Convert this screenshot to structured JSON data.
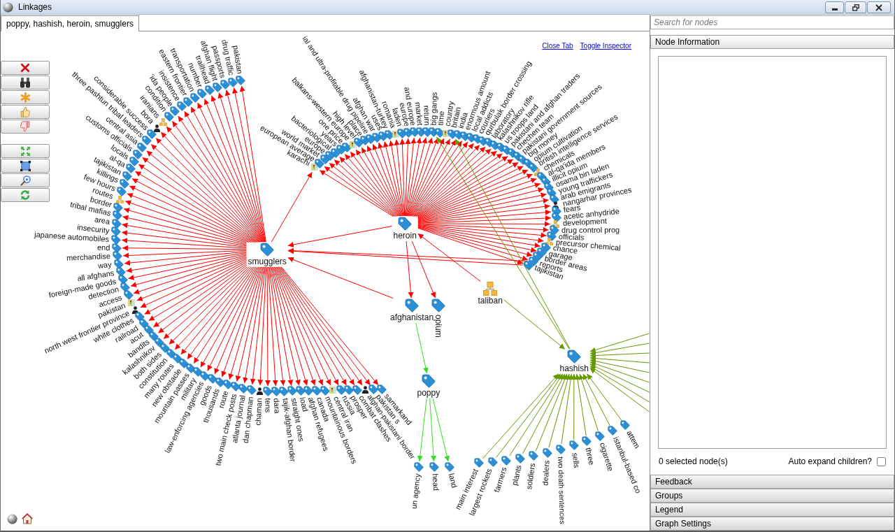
{
  "window": {
    "title": "Linkages"
  },
  "tabs": [
    {
      "label": "poppy, hashish, heroin, smugglers",
      "selected": true
    }
  ],
  "canvas_links": [
    {
      "label": "Close Tab"
    },
    {
      "label": "Toggle Inspector"
    }
  ],
  "graph": {
    "nodes": [
      {
        "label": "smugglers",
        "kind": "term",
        "color": "#ff0000",
        "arrows_point_outward": true,
        "children": [
          {
            "label": "pakistan",
            "kind": "term"
          },
          {
            "label": "drug traffic",
            "kind": "term"
          },
          {
            "label": "passports",
            "kind": "term"
          },
          {
            "label": "afghan flight",
            "kind": "term"
          },
          {
            "label": "trailhead",
            "kind": "term"
          },
          {
            "label": "number",
            "kind": "term"
          },
          {
            "label": "transportation",
            "kind": "term"
          },
          {
            "label": "eastern frontier",
            "kind": "term"
          },
          {
            "label": "insistence",
            "kind": "term"
          },
          {
            "label": "'ida people",
            "kind": "term"
          },
          {
            "label": "condition",
            "kind": "term"
          },
          {
            "label": "iranians",
            "kind": "group"
          },
          {
            "label": "bora",
            "kind": "person"
          },
          {
            "label": "considerable success",
            "kind": "term"
          },
          {
            "label": "three pashtun tribal leaders",
            "kind": "term"
          },
          {
            "label": "central asia",
            "kind": "term"
          },
          {
            "label": "customs officials",
            "kind": "term"
          },
          {
            "label": "locals",
            "kind": "term"
          },
          {
            "label": "al-qa",
            "kind": "term"
          },
          {
            "label": "tajikistan",
            "kind": "term"
          },
          {
            "label": "killings",
            "kind": "term"
          },
          {
            "label": "few hours",
            "kind": "term"
          },
          {
            "label": "routes",
            "kind": "group"
          },
          {
            "label": "border",
            "kind": "term"
          },
          {
            "label": "tribal mafias",
            "kind": "term"
          },
          {
            "label": "area",
            "kind": "term"
          },
          {
            "label": "insecurity",
            "kind": "term"
          },
          {
            "label": "japanese automobiles",
            "kind": "term"
          },
          {
            "label": "end",
            "kind": "term"
          },
          {
            "label": "merchandise",
            "kind": "term"
          },
          {
            "label": "way",
            "kind": "term"
          },
          {
            "label": "all afghans",
            "kind": "term"
          },
          {
            "label": "foreign-made goods",
            "kind": "term"
          },
          {
            "label": "detection",
            "kind": "term"
          },
          {
            "label": "access",
            "kind": "term"
          },
          {
            "label": "pakistan",
            "kind": "place"
          },
          {
            "label": "north west frontier province",
            "kind": "person"
          },
          {
            "label": "white clothes",
            "kind": "term"
          },
          {
            "label": "railroad",
            "kind": "term"
          },
          {
            "label": "acut",
            "kind": "term"
          },
          {
            "label": "bandits",
            "kind": "term"
          },
          {
            "label": "kalashnikov",
            "kind": "term"
          },
          {
            "label": "both sides",
            "kind": "term"
          },
          {
            "label": "constitution",
            "kind": "term"
          },
          {
            "label": "many routes",
            "kind": "term"
          },
          {
            "label": "new obstacle",
            "kind": "term"
          },
          {
            "label": "mountain passes",
            "kind": "term"
          },
          {
            "label": "military",
            "kind": "term"
          },
          {
            "label": "law-enforcing agencies",
            "kind": "term"
          },
          {
            "label": "goods",
            "kind": "term"
          },
          {
            "label": "thousands",
            "kind": "term"
          },
          {
            "label": "route",
            "kind": "term"
          },
          {
            "label": "two main check posts",
            "kind": "term"
          },
          {
            "label": "atlanta journal",
            "kind": "term"
          },
          {
            "label": "dan chapman",
            "kind": "term"
          },
          {
            "label": "chaman",
            "kind": "person"
          },
          {
            "label": "tens",
            "kind": "term"
          },
          {
            "label": "dara",
            "kind": "term"
          },
          {
            "label": "tajik-afghan border",
            "kind": "term"
          },
          {
            "label": "straight ones",
            "kind": "term"
          },
          {
            "label": "load",
            "kind": "term"
          },
          {
            "label": "afghan refugees",
            "kind": "term"
          },
          {
            "label": "canada",
            "kind": "term"
          },
          {
            "label": "mountainous borders",
            "kind": "term"
          },
          {
            "label": "central iran",
            "kind": "place"
          },
          {
            "label": "russia",
            "kind": "term"
          },
          {
            "label": "prosper",
            "kind": "term"
          },
          {
            "label": "combat clashes",
            "kind": "term"
          },
          {
            "label": "afghan-pakistani border",
            "kind": "person"
          },
          {
            "label": "pakistan s",
            "kind": "term"
          },
          {
            "label": "samarkand",
            "kind": "term"
          }
        ]
      },
      {
        "label": "heroin",
        "kind": "term",
        "color": "#ff0000",
        "arrows_point_outward": true,
        "children": [
          {
            "label": "karachi",
            "kind": "place"
          },
          {
            "label": "european average",
            "kind": "term"
          },
          {
            "label": "world market",
            "kind": "term"
          },
          {
            "label": "europe",
            "kind": "term"
          },
          {
            "label": "bacteriological",
            "kind": "term"
          },
          {
            "label": "years",
            "kind": "term"
          },
          {
            "label": "one price",
            "kind": "term"
          },
          {
            "label": "balkans-western europe",
            "kind": "place"
          },
          {
            "label": "high level",
            "kind": "term"
          },
          {
            "label": "place",
            "kind": "term"
          },
          {
            "label": "ial and ultra-profitable drug pipeline",
            "kind": "term"
          },
          {
            "label": "afghan war",
            "kind": "term"
          },
          {
            "label": "uses",
            "kind": "term"
          },
          {
            "label": "afghanistan-turkey",
            "kind": "term"
          },
          {
            "label": "romania",
            "kind": "place"
          },
          {
            "label": "laden",
            "kind": "term"
          },
          {
            "label": "europe",
            "kind": "term"
          },
          {
            "label": "and europe",
            "kind": "term"
          },
          {
            "label": "market",
            "kind": "term"
          },
          {
            "label": "return",
            "kind": "term"
          },
          {
            "label": "big gangs",
            "kind": "term"
          },
          {
            "label": "time",
            "kind": "term"
          },
          {
            "label": "country",
            "kind": "place"
          },
          {
            "label": "britain",
            "kind": "term"
          },
          {
            "label": "india",
            "kind": "term"
          },
          {
            "label": "enormous amount",
            "kind": "term"
          },
          {
            "label": "local addicts",
            "kind": "term"
          },
          {
            "label": "couriers",
            "kind": "term"
          },
          {
            "label": "qurbulak border crossing",
            "kind": "term"
          },
          {
            "label": "laboratory",
            "kind": "term"
          },
          {
            "label": "kalashnikov rifle",
            "kind": "term"
          },
          {
            "label": "us troops land",
            "kind": "term"
          },
          {
            "label": "pakistani and afghan traders",
            "kind": "term"
          },
          {
            "label": "chechen team",
            "kind": "term"
          },
          {
            "label": "pakistani government sources",
            "kind": "term"
          },
          {
            "label": "big money",
            "kind": "term"
          },
          {
            "label": "opium cultivation",
            "kind": "term"
          },
          {
            "label": "british intelligence services",
            "kind": "term"
          },
          {
            "label": "chemicals",
            "kind": "group"
          },
          {
            "label": "al-qa'ida members",
            "kind": "term"
          },
          {
            "label": "illicit opium",
            "kind": "term"
          },
          {
            "label": "osama bin laden",
            "kind": "term"
          },
          {
            "label": "young traffickers",
            "kind": "term"
          },
          {
            "label": "arab emigrants",
            "kind": "term"
          },
          {
            "label": "nangarhar provinces",
            "kind": "person"
          },
          {
            "label": "fears",
            "kind": "term"
          },
          {
            "label": "acetic anhydride",
            "kind": "term"
          },
          {
            "label": "development",
            "kind": "group"
          },
          {
            "label": "drug control prog",
            "kind": "term"
          },
          {
            "label": "officials",
            "kind": "term"
          },
          {
            "label": "precursor chemical",
            "kind": "group"
          },
          {
            "label": "chance",
            "kind": "term"
          },
          {
            "label": "garage",
            "kind": "term"
          },
          {
            "label": "border areas",
            "kind": "term"
          },
          {
            "label": "reports",
            "kind": "term"
          },
          {
            "label": "tajikistan",
            "kind": "term"
          }
        ]
      },
      {
        "label": "afghanistan",
        "kind": "term"
      },
      {
        "label": "opium",
        "kind": "term"
      },
      {
        "label": "taliban",
        "kind": "group"
      },
      {
        "label": "hashish",
        "kind": "term",
        "color": "#669900",
        "arrows_point_outward": false,
        "children": [
          {
            "label": "main interest",
            "kind": "term"
          },
          {
            "label": "largest rockets",
            "kind": "term"
          },
          {
            "label": "farmers",
            "kind": "term"
          },
          {
            "label": "plants",
            "kind": "term"
          },
          {
            "label": "soldiers",
            "kind": "term"
          },
          {
            "label": "dealers",
            "kind": "term"
          },
          {
            "label": "two death sentences",
            "kind": "term"
          },
          {
            "label": "sells",
            "kind": "term"
          },
          {
            "label": "three",
            "kind": "term"
          },
          {
            "label": "cigarette",
            "kind": "term"
          },
          {
            "label": "istanbul-based co",
            "kind": "term"
          },
          {
            "label": "attem",
            "kind": "term"
          }
        ]
      },
      {
        "label": "poppy",
        "kind": "term",
        "color": "#33dd22",
        "arrows_point_outward": true,
        "children": [
          {
            "label": "un agency",
            "kind": "term"
          },
          {
            "label": "head",
            "kind": "term"
          },
          {
            "label": "land",
            "kind": "term"
          }
        ]
      }
    ]
  },
  "search": {
    "placeholder": "Search for nodes"
  },
  "sections": [
    {
      "title": "Node Information",
      "expanded": true,
      "status": "0 selected node(s)",
      "auto_expand": {
        "label": "Auto expand children?",
        "checked": false
      }
    },
    {
      "title": "Feedback",
      "expanded": false
    },
    {
      "title": "Groups",
      "expanded": false
    },
    {
      "title": "Legend",
      "expanded": false
    },
    {
      "title": "Graph Settings",
      "expanded": false
    }
  ]
}
